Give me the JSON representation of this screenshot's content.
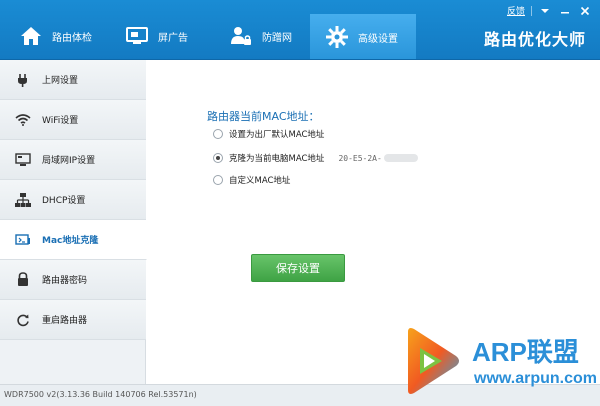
{
  "window_controls": {
    "feedback_label": "反馈"
  },
  "tabs": [
    {
      "label": "路由体检",
      "icon": "home-icon"
    },
    {
      "label": "屏广告",
      "icon": "monitor-icon"
    },
    {
      "label": "防蹭网",
      "icon": "user-lock-icon"
    },
    {
      "label": "高级设置",
      "icon": "gear-icon"
    }
  ],
  "brand": "路由优化大师",
  "sidebar": {
    "items": [
      {
        "label": "上网设置",
        "icon": "plug-icon"
      },
      {
        "label": "WiFi设置",
        "icon": "wifi-icon"
      },
      {
        "label": "局域网IP设置",
        "icon": "lan-icon"
      },
      {
        "label": "DHCP设置",
        "icon": "network-icon"
      },
      {
        "label": "Mac地址克隆",
        "icon": "mac-clone-icon"
      },
      {
        "label": "路由器密码",
        "icon": "lock-icon"
      },
      {
        "label": "重启路由器",
        "icon": "restart-icon"
      }
    ],
    "active_index": 4
  },
  "main": {
    "title": "路由器当前MAC地址：",
    "options": [
      {
        "label": "设置为出厂默认MAC地址",
        "checked": false
      },
      {
        "label": "克隆为当前电脑MAC地址",
        "checked": true,
        "value": "20-E5-2A-"
      },
      {
        "label": "自定义MAC地址",
        "checked": false
      }
    ],
    "save_label": "保存设置"
  },
  "footer": {
    "version": "WDR7500 v2(3.13.36 Build 140706 Rel.53571n)"
  },
  "watermark": {
    "brand": "ARP联盟",
    "url": "www.arpun.com"
  },
  "colors": {
    "header": "#1a8cd4",
    "accent": "#1a6fb4",
    "save_button": "#4cae50",
    "sidebar": "#eef2f5"
  }
}
